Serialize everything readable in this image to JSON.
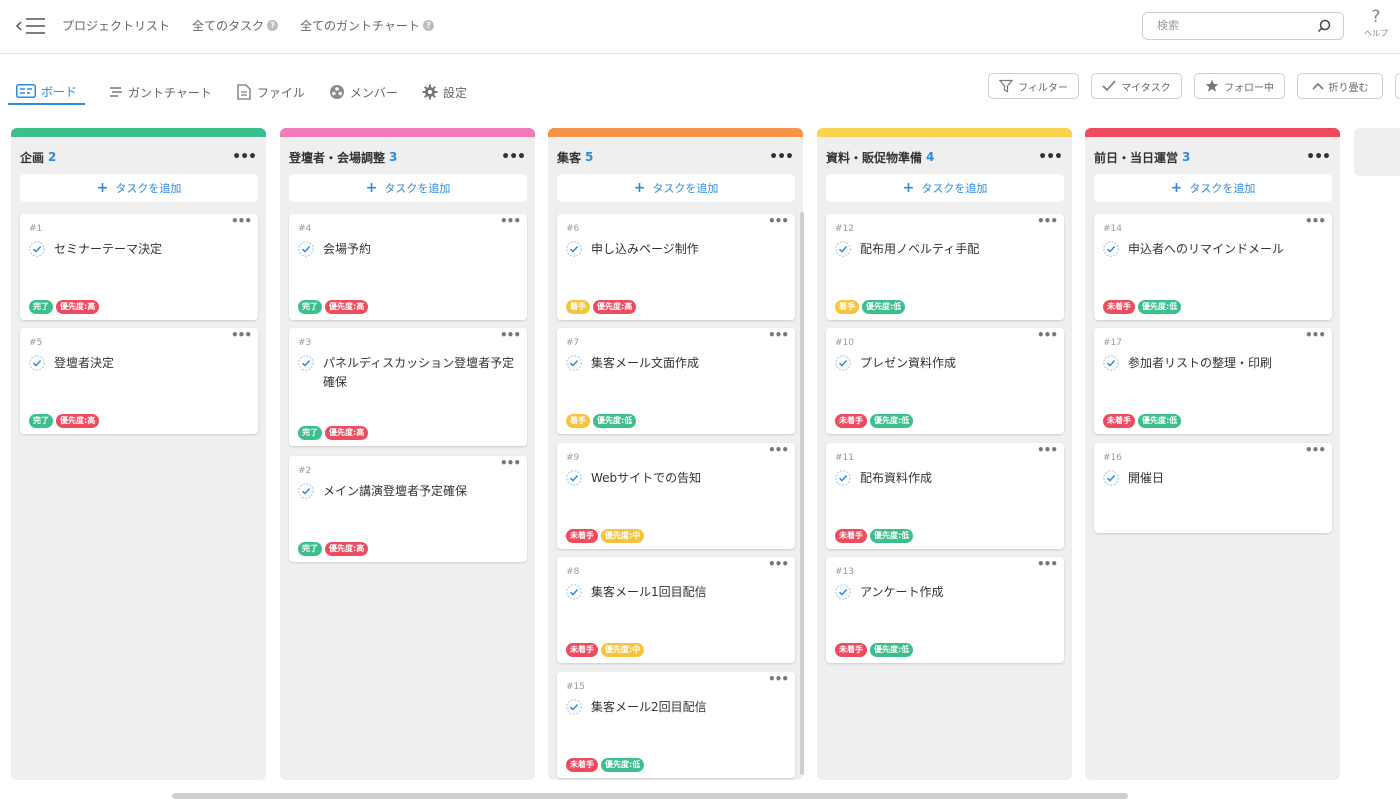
{
  "colors": {
    "accent": "#2a8be0",
    "col_planning": "#3cbf8c",
    "col_speakers": "#f27cb8",
    "col_attract": "#f5944a",
    "col_materials": "#f7d34e",
    "col_eventday": "#ef4b5f",
    "tag_done": "#3cbf8c",
    "tag_doing": "#f7c53d",
    "tag_todo": "#ef4b5f",
    "prio_high": "#ef4b5f",
    "prio_mid": "#f7c53d",
    "prio_low": "#3cbf8c"
  },
  "topbar": {
    "links": [
      "プロジェクトリスト",
      "全てのタスク",
      "全てのガントチャート"
    ],
    "search_placeholder": "検索",
    "help_label": "ヘルプ",
    "help_symbol": "?"
  },
  "view_tabs": [
    "ボード",
    "ガントチャート",
    "ファイル",
    "メンバー",
    "設定"
  ],
  "toolbar": {
    "filter": "フィルター",
    "my_tasks": "マイタスク",
    "following": "フォロー中",
    "collapse": "折り畳む"
  },
  "add_task_label": "タスクを追加",
  "columns": [
    {
      "title": "企画",
      "count": "2",
      "color": "#3cbf8c",
      "cards": [
        {
          "num": "#1",
          "title": "セミナーテーマ決定",
          "status": "完了",
          "priority": "優先度:高"
        },
        {
          "num": "#5",
          "title": "登壇者決定",
          "status": "完了",
          "priority": "優先度:高"
        }
      ]
    },
    {
      "title": "登壇者・会場調整",
      "count": "3",
      "color": "#f27cb8",
      "cards": [
        {
          "num": "#4",
          "title": "会場予約",
          "status": "完了",
          "priority": "優先度:高"
        },
        {
          "num": "#3",
          "title": "パネルディスカッション登壇者予定確保",
          "status": "完了",
          "priority": "優先度:高"
        },
        {
          "num": "#2",
          "title": "メイン講演登壇者予定確保",
          "status": "完了",
          "priority": "優先度:高"
        }
      ]
    },
    {
      "title": "集客",
      "count": "5",
      "color": "#f5944a",
      "cards": [
        {
          "num": "#6",
          "title": "申し込みページ制作",
          "status": "着手",
          "priority": "優先度:高"
        },
        {
          "num": "#7",
          "title": "集客メール文面作成",
          "status": "着手",
          "priority": "優先度:低"
        },
        {
          "num": "#9",
          "title": "Webサイトでの告知",
          "status": "未着手",
          "priority": "優先度:中"
        },
        {
          "num": "#8",
          "title": "集客メール1回目配信",
          "status": "未着手",
          "priority": "優先度:中"
        },
        {
          "num": "#15",
          "title": "集客メール2回目配信",
          "status": "未着手",
          "priority": "優先度:低"
        }
      ]
    },
    {
      "title": "資料・販促物準備",
      "count": "4",
      "color": "#f7d34e",
      "cards": [
        {
          "num": "#12",
          "title": "配布用ノベルティ手配",
          "status": "着手",
          "priority": "優先度:低"
        },
        {
          "num": "#10",
          "title": "プレゼン資料作成",
          "status": "未着手",
          "priority": "優先度:低"
        },
        {
          "num": "#11",
          "title": "配布資料作成",
          "status": "未着手",
          "priority": "優先度:低"
        },
        {
          "num": "#13",
          "title": "アンケート作成",
          "status": "未着手",
          "priority": "優先度:低"
        }
      ]
    },
    {
      "title": "前日・当日運営",
      "count": "3",
      "color": "#ef4b5f",
      "cards": [
        {
          "num": "#14",
          "title": "申込者へのリマインドメール",
          "status": "未着手",
          "priority": "優先度:低"
        },
        {
          "num": "#17",
          "title": "参加者リストの整理・印刷",
          "status": "未着手",
          "priority": "優先度:低"
        },
        {
          "num": "#16",
          "title": "開催日",
          "status": "",
          "priority": ""
        }
      ]
    }
  ]
}
